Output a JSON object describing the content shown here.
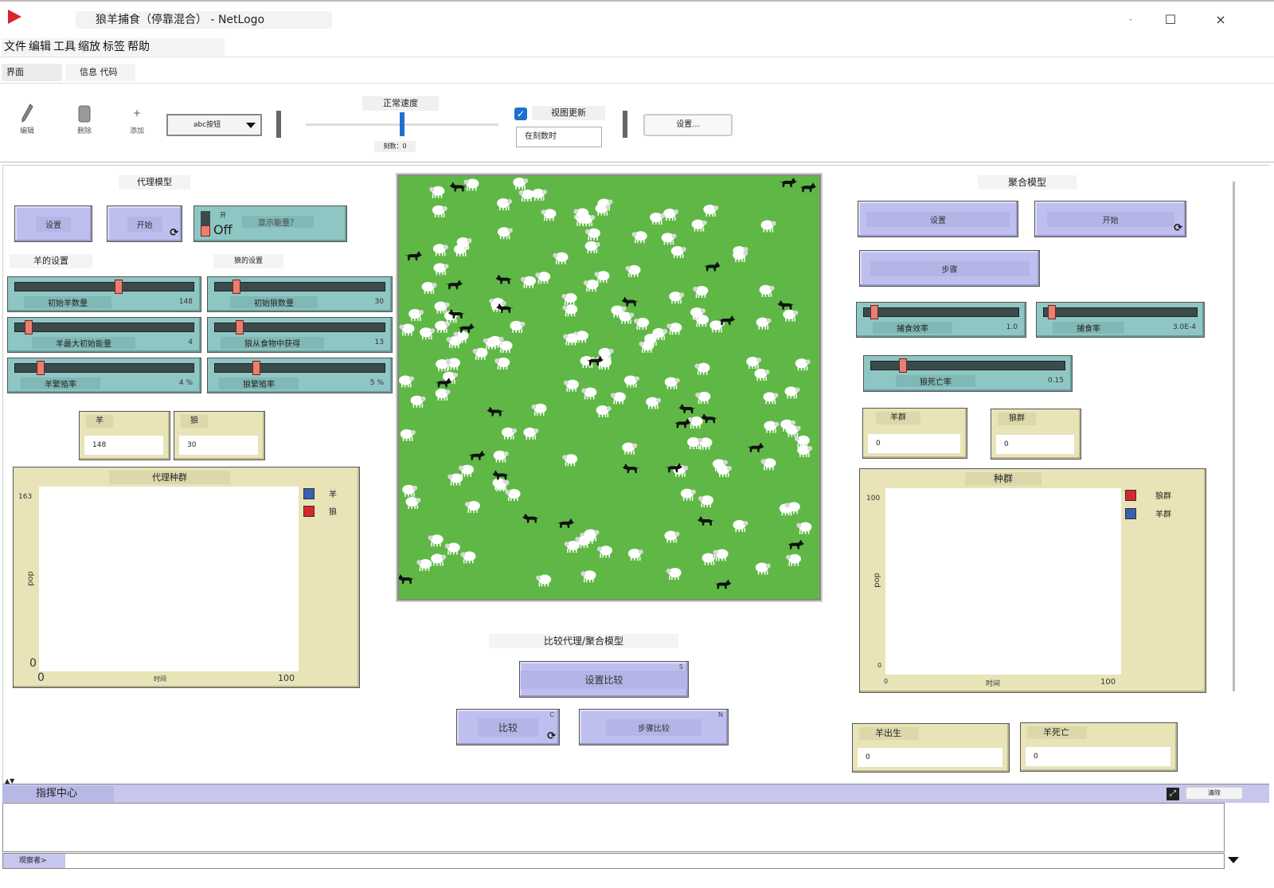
{
  "window": {
    "title": "狼羊捕食（停靠混合） - NetLogo",
    "minimize": "-",
    "maximize": "☐",
    "close": "×"
  },
  "menu": [
    "文件",
    "编辑",
    "工具",
    "缩放",
    "标签",
    "帮助"
  ],
  "tabs": [
    "界面",
    "信息 代码"
  ],
  "toolbar": {
    "edit": "编辑",
    "delete": "删除",
    "add": "添加",
    "add_plus": "+",
    "widget_select": "abc按钮",
    "speed_label": "正常速度",
    "speed_fraction": 0.5,
    "ticks": "刻数：0",
    "view_updates": "视图更新",
    "update_mode": "在刻数时",
    "settings": "设置..."
  },
  "agent": {
    "title": "代理模型",
    "setup": "设置",
    "go": "开始",
    "go_icon": "⟳",
    "switch_label": "显示能量？",
    "switch_state": "Off",
    "switch_on": "开",
    "sheep_settings": "羊的设置",
    "wolf_settings": "狼的设置",
    "sliders": [
      {
        "name": "初始羊数量",
        "value": "148",
        "fraction": 0.58
      },
      {
        "name": "初始狼数量",
        "value": "30",
        "fraction": 0.11
      },
      {
        "name": "羊最大初始能量",
        "value": "4",
        "fraction": 0.06
      },
      {
        "name": "狼从食物中获得",
        "value": "13",
        "fraction": 0.13
      },
      {
        "name": "羊繁殖率",
        "value": "4 %",
        "fraction": 0.13
      },
      {
        "name": "狼繁殖率",
        "value": "5 %",
        "fraction": 0.23
      }
    ],
    "monitors": [
      {
        "name": "羊",
        "value": "148"
      },
      {
        "name": "狼",
        "value": "30"
      }
    ],
    "plot": {
      "title": "代理种群",
      "ylabel": "pop",
      "xlabel": "时间",
      "ymax": "163",
      "ymin": "0",
      "xmin": "0",
      "xmax": "100",
      "legend": [
        {
          "name": "羊",
          "color": "#3a5fb0"
        },
        {
          "name": "狼",
          "color": "#d8262c"
        }
      ]
    }
  },
  "compare": {
    "title": "比较代理/聚合模型",
    "setup": "设置比较",
    "setup_key": "S",
    "compare": "比较",
    "compare_icon": "⟳",
    "compare_key": "C",
    "step": "步骤比较",
    "step_key": "N"
  },
  "aggregate": {
    "title": "聚合模型",
    "setup": "设置",
    "go": "开始",
    "go_icon": "⟳",
    "step": "步骤",
    "sliders": [
      {
        "name": "捕食效率",
        "value": "1.0",
        "fraction": 0.05
      },
      {
        "name": "捕食率",
        "value": "3.0E-4",
        "fraction": 0.03
      },
      {
        "name": "狼死亡率",
        "value": "0.15",
        "fraction": 0.15
      }
    ],
    "monitors": [
      {
        "name": "羊群",
        "value": "0"
      },
      {
        "name": "狼群",
        "value": "0"
      },
      {
        "name": "羊出生",
        "value": "0"
      },
      {
        "name": "羊死亡",
        "value": "0"
      }
    ],
    "plot": {
      "title": "种群",
      "ylabel": "pop",
      "xlabel": "时间",
      "ymax": "100",
      "ymin": "0",
      "xmin": "0",
      "xmax": "100",
      "legend": [
        {
          "name": "狼群",
          "color": "#d8262c"
        },
        {
          "name": "羊群",
          "color": "#3a5fb0"
        }
      ]
    }
  },
  "command_center": {
    "title": "指挥中心",
    "clear": "清除",
    "observer": "观察者>"
  }
}
